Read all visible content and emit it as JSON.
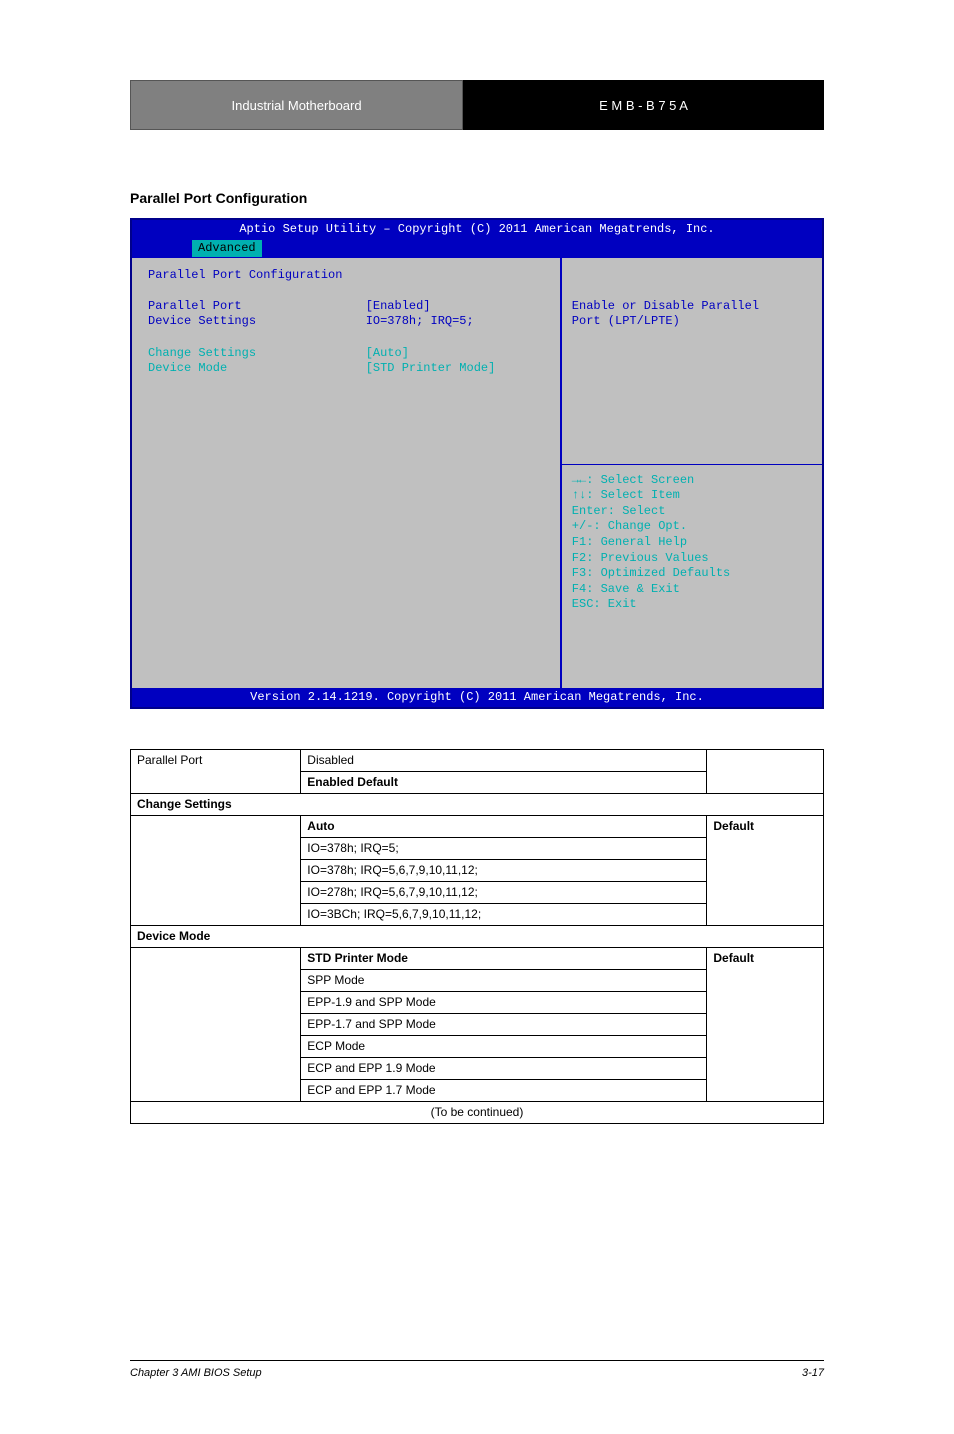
{
  "header": {
    "left": "Industrial Motherboard",
    "right": "E M B - B 7 5 A"
  },
  "section_title": "Parallel Port Configuration",
  "bios": {
    "top": "Aptio Setup Utility – Copyright (C) 2011 American Megatrends, Inc.",
    "tab": "Advanced",
    "heading": "Parallel Port Configuration",
    "rows": [
      {
        "label": "Parallel Port",
        "value": "[Enabled]",
        "hl": false
      },
      {
        "label": "Device Settings",
        "value": "IO=378h; IRQ=5;",
        "hl": false
      },
      {
        "label": "",
        "value": "",
        "hl": false
      },
      {
        "label": "Change Settings",
        "value": "[Auto]",
        "hl": true
      },
      {
        "label": "Device Mode",
        "value": "[STD Printer Mode]",
        "hl": true
      }
    ],
    "help_top": "Enable or Disable Parallel\nPort (LPT/LPTE)",
    "nav": "→←: Select Screen\n↑↓: Select Item\nEnter: Select\n+/-: Change Opt.\nF1: General Help\nF2: Previous Values\nF3: Optimized Defaults\nF4: Save & Exit\nESC: Exit",
    "bottom": "Version 2.14.1219. Copyright (C) 2011 American Megatrends, Inc."
  },
  "table": {
    "headers": [
      "Parallel Port",
      "Disabled",
      ""
    ],
    "header_default": "Enabled                    Default",
    "sections": [
      {
        "title": "Change Settings",
        "options": [
          "Auto",
          "IO=378h; IRQ=5;",
          "IO=378h; IRQ=5,6,7,9,10,11,12;",
          "IO=278h; IRQ=5,6,7,9,10,11,12;",
          "IO=3BCh; IRQ=5,6,7,9,10,11,12;"
        ],
        "default_row": 0,
        "default_label": "Default"
      },
      {
        "title": "Device Mode",
        "options": [
          "STD Printer Mode",
          "SPP Mode",
          "EPP-1.9 and SPP Mode",
          "EPP-1.7 and SPP Mode",
          "ECP Mode",
          "ECP and EPP 1.9 Mode",
          "ECP and EPP 1.7 Mode"
        ],
        "default_row": 0,
        "default_label": "Default"
      }
    ],
    "footer_row": "(To be continued)"
  },
  "footer": {
    "left": "Chapter 3 AMI BIOS Setup",
    "right": "3-17"
  }
}
